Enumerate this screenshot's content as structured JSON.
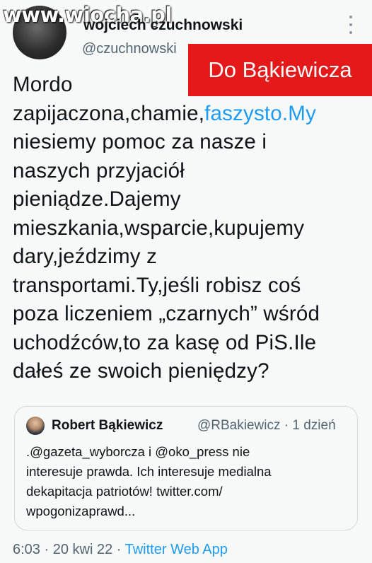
{
  "watermark": "www.wiocha.pl",
  "author": {
    "name": "wojciech czuchnowski",
    "handle": "@czuchnowski"
  },
  "banner": "Do Bąkiewicza",
  "tweet": {
    "l1": "Mordo",
    "l2a": "zapijaczona,chamie,",
    "l2b": "faszysto.My",
    "l3": "niesiemy pomoc za nasze i",
    "l4": "naszych przyjaciół",
    "l5": "pieniądze.Dajemy",
    "l6": "mieszkania,wsparcie,kupujemy",
    "l7": "dary,jeździmy z",
    "l8": "transportami.Ty,jeśli robisz coś",
    "l9": "poza liczeniem „czarnych” wśród",
    "l10": "uchodźców,to za kasę od PiS.Ile",
    "l11": "dałeś ze swoich pieniędzy?"
  },
  "quote": {
    "name": "Robert Bąkiewicz",
    "meta": "@RBakiewicz · 1 dzień",
    "l1": ".@gazeta_wyborcza i @oko_press nie",
    "l2": "interesuje prawda. Ich interesuje medialna",
    "l3": "dekapitacja patriotów! twitter.com/",
    "l4": "wpogonizaprawd..."
  },
  "footer": {
    "time": "6:03 · 20 kwi 22 · ",
    "source": "Twitter Web App"
  },
  "colors": {
    "banner": "#e51919",
    "link": "#1d9bf0",
    "secondary": "#536471",
    "background": "#f7f8f8"
  }
}
